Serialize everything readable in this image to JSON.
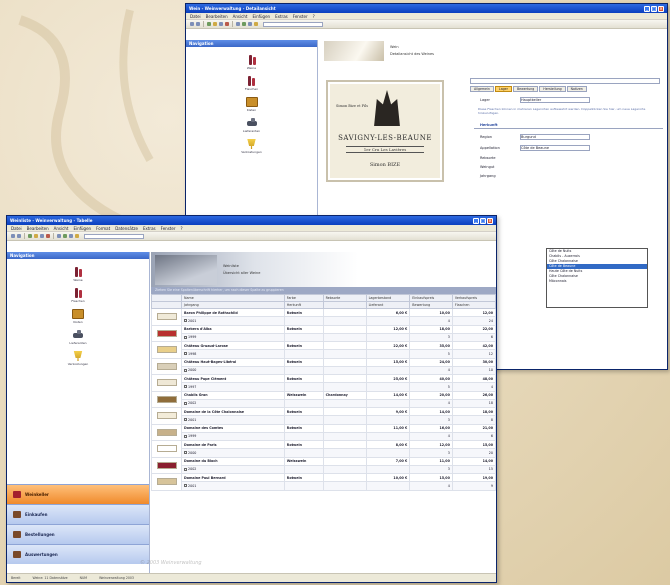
{
  "back_window": {
    "title": "Wein - Weinverwaltung - Detailansicht",
    "menu": [
      "Datei",
      "Bearbeiten",
      "Ansicht",
      "Einfügen",
      "Extras",
      "Fenster",
      "?"
    ],
    "nav_title": "Navigation",
    "nav_items": [
      "Weine",
      "Flaschen",
      "Kisten",
      "Lieferanten",
      "Verkostungen"
    ],
    "header_line1": "Wein",
    "header_line2": "Detailansicht des Weines",
    "wine_label": {
      "title": "SAVIGNY-LES-BEAUNE",
      "sub": "1er Cru  Les Lavières",
      "producer": "Simon BIZE",
      "top": "Simon Bize et Fils"
    },
    "form": {
      "tabs": [
        "Allgemein",
        "Lager",
        "Bewertung",
        "Herstellung",
        "Notizen"
      ],
      "label_lager": "Lager",
      "value_lager": "Hauptkeller",
      "note": "Diese Flaschen können in mehreren Lagerorten aufbewahrt werden. Doppelklicken Sie hier, um neue Lagerorte hinzuzufügen.",
      "section": "Herkunft",
      "label_region": "Region",
      "value_region": "Burgund",
      "label_appellation": "Appellation",
      "value_appellation": "Côte de Beaune",
      "label_rebsorte": "Rebsorte",
      "label_weingut": "Weingut",
      "label_jahrgang": "Jahrgang"
    },
    "dropdown": [
      "Côte de Nuits",
      "Chablis - Auxerrois",
      "Côte Chalonnaise",
      "Côte de Beaune",
      "Haute Côte de Nuits",
      "Côte Chalonnaise",
      "Mâconnais"
    ],
    "dropdown_selected": 3
  },
  "front_window": {
    "title": "Weinliste - Weinverwaltung - Tabelle",
    "menu": [
      "Datei",
      "Bearbeiten",
      "Ansicht",
      "Einfügen",
      "Format",
      "Datensätze",
      "Extras",
      "Fenster",
      "?"
    ],
    "nav_title": "Navigation",
    "nav_items": [
      "Weine",
      "Flaschen",
      "Kisten",
      "Lieferanten",
      "Verkostungen"
    ],
    "tabs": [
      "Weinkeller",
      "Einkaufen",
      "Bestellungen",
      "Auswertungen"
    ],
    "header_line1": "Weinliste",
    "header_line2": "Übersicht aller Weine",
    "groupbar": "Ziehen Sie eine Spaltenüberschrift hierher, um nach dieser Spalte zu gruppieren",
    "columns": [
      "",
      "Name",
      "Farbe",
      "Rebsorte",
      "Lagerbestand",
      "Einkaufspreis",
      "Verkaufspreis"
    ],
    "subcolumns": [
      "",
      "Jahrgang",
      "Herkunft",
      "",
      "Lieferant",
      "Bewertung",
      "Flaschen"
    ],
    "rows": [
      {
        "name": "Baron Philippe de Rothschild",
        "color": "Rotwein",
        "grape": "",
        "stock": "6,00 €",
        "buy": "10,00",
        "sell": "12,00",
        "vintage": "2001",
        "origin": "",
        "supplier": "",
        "rating": "4",
        "bottles": "24"
      },
      {
        "name": "Barbera d'Alba",
        "color": "Rotwein",
        "grape": "",
        "stock": "12,00 €",
        "buy": "18,00",
        "sell": "22,00",
        "vintage": "1999",
        "origin": "",
        "supplier": "",
        "rating": "3",
        "bottles": "6"
      },
      {
        "name": "Château Gruaud-Larose",
        "color": "Rotwein",
        "grape": "",
        "stock": "22,00 €",
        "buy": "35,00",
        "sell": "42,00",
        "vintage": "1998",
        "origin": "",
        "supplier": "",
        "rating": "5",
        "bottles": "12"
      },
      {
        "name": "Château Haut-Bages-Libéral",
        "color": "Rotwein",
        "grape": "",
        "stock": "15,00 €",
        "buy": "24,00",
        "sell": "30,00",
        "vintage": "2000",
        "origin": "",
        "supplier": "",
        "rating": "4",
        "bottles": "10"
      },
      {
        "name": "Château Pape Clément",
        "color": "Rotwein",
        "grape": "",
        "stock": "25,00 €",
        "buy": "40,00",
        "sell": "48,00",
        "vintage": "1997",
        "origin": "",
        "supplier": "",
        "rating": "5",
        "bottles": "4"
      },
      {
        "name": "Chablis Gran",
        "color": "Weisswein",
        "grape": "Chardonnay",
        "stock": "14,00 €",
        "buy": "20,00",
        "sell": "26,00",
        "vintage": "2002",
        "origin": "",
        "supplier": "",
        "rating": "4",
        "bottles": "18"
      },
      {
        "name": "Domaine de la Côte Chalonnaise",
        "color": "Rotwein",
        "grape": "",
        "stock": "9,00 €",
        "buy": "14,00",
        "sell": "18,00",
        "vintage": "2001",
        "origin": "",
        "supplier": "",
        "rating": "3",
        "bottles": "8"
      },
      {
        "name": "Domaine des Comtes",
        "color": "Rotwein",
        "grape": "",
        "stock": "11,00 €",
        "buy": "16,00",
        "sell": "21,00",
        "vintage": "1999",
        "origin": "",
        "supplier": "",
        "rating": "4",
        "bottles": "6"
      },
      {
        "name": "Domaine de Paris",
        "color": "Rotwein",
        "grape": "",
        "stock": "8,00 €",
        "buy": "12,00",
        "sell": "15,00",
        "vintage": "2000",
        "origin": "",
        "supplier": "",
        "rating": "3",
        "bottles": "20"
      },
      {
        "name": "Domaine du Bloch",
        "color": "Weisswein",
        "grape": "",
        "stock": "7,00 €",
        "buy": "11,00",
        "sell": "14,00",
        "vintage": "2002",
        "origin": "",
        "supplier": "",
        "rating": "3",
        "bottles": "15"
      },
      {
        "name": "Domaine Paul Bernard",
        "color": "Rotwein",
        "grape": "",
        "stock": "10,00 €",
        "buy": "15,00",
        "sell": "19,00",
        "vintage": "2001",
        "origin": "",
        "supplier": "",
        "rating": "4",
        "bottles": "9"
      }
    ],
    "status": [
      "Bereit",
      "Weine: 11 Datensätze",
      "NUM",
      "Weinverwaltung 2003"
    ]
  },
  "watermark": "© 2003 Weinverwaltung"
}
